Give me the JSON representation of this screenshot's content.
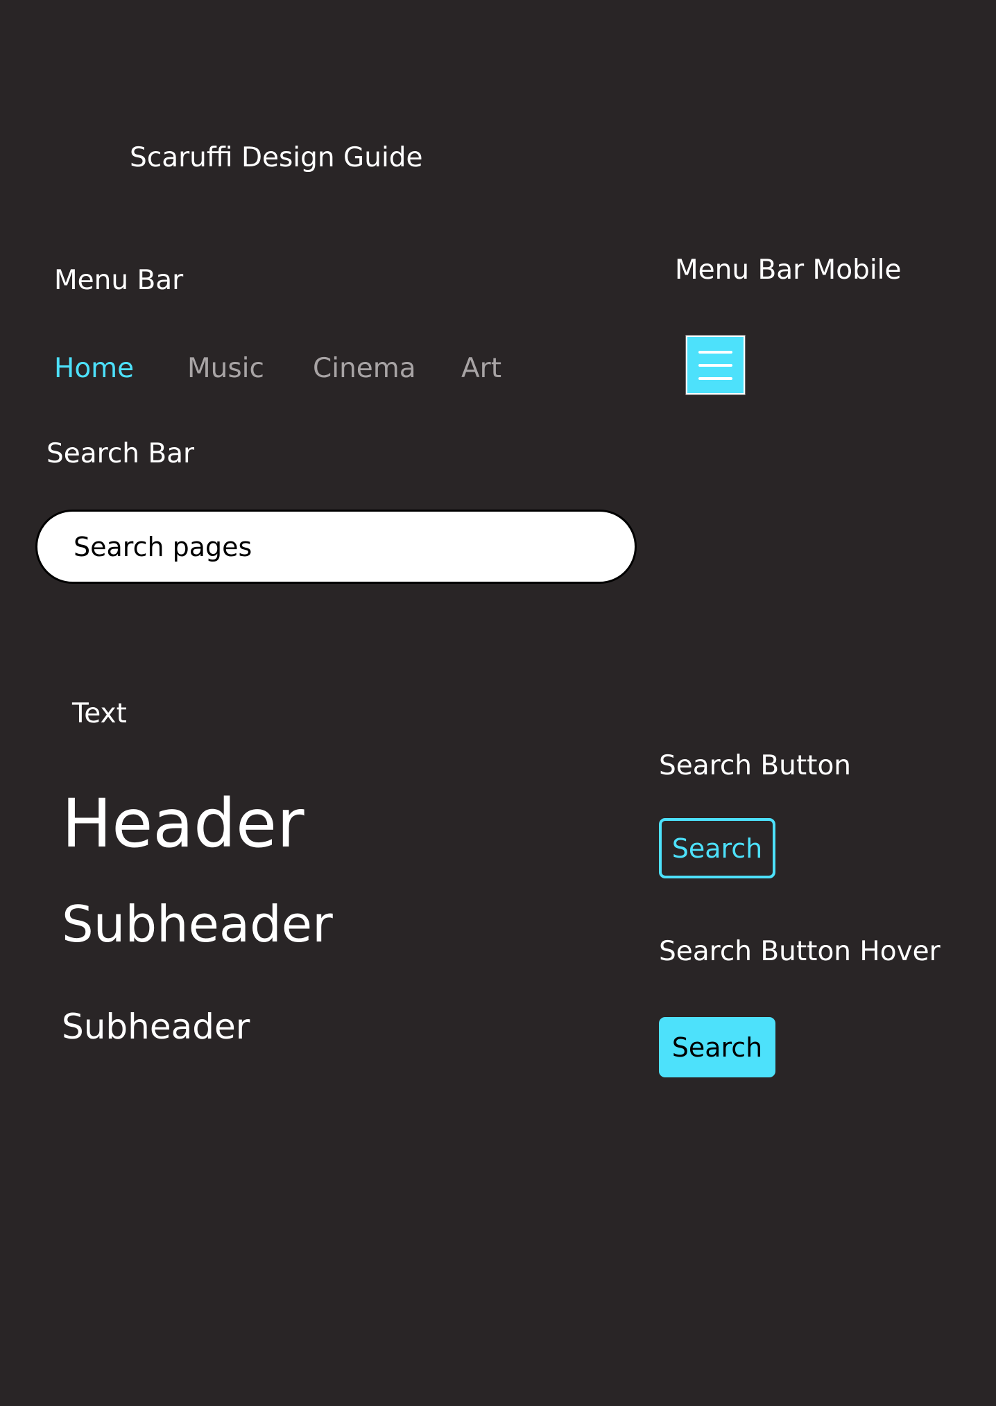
{
  "page_title": "Scaruffi Design Guide",
  "menu_bar": {
    "label": "Menu Bar",
    "items": [
      {
        "label": "Home",
        "active": true
      },
      {
        "label": "Music",
        "active": false
      },
      {
        "label": "Cinema",
        "active": false
      },
      {
        "label": "Art",
        "active": false
      }
    ]
  },
  "menu_bar_mobile": {
    "label": "Menu Bar Mobile",
    "icon": "hamburger-menu-icon"
  },
  "search_bar": {
    "label": "Search Bar",
    "placeholder": "Search pages"
  },
  "text_section": {
    "label": "Text",
    "header": "Header",
    "subheader_large": "Subheader",
    "subheader_small": "Subheader"
  },
  "search_button": {
    "label": "Search Button",
    "button_label": "Search"
  },
  "search_button_hover": {
    "label": "Search Button Hover",
    "button_label": "Search"
  },
  "colors": {
    "background": "#292526",
    "accent": "#4de1fb",
    "text": "#ffffff",
    "nav_inactive": "#a8a4a5"
  }
}
